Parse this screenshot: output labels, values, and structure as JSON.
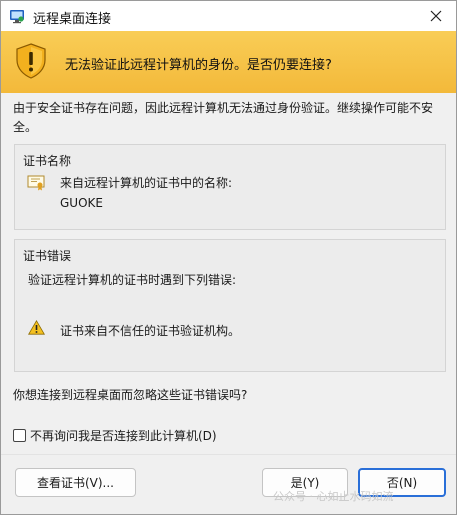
{
  "window": {
    "title": "远程桌面连接"
  },
  "banner": {
    "message": "无法验证此远程计算机的身份。是否仍要连接?"
  },
  "intro": "由于安全证书存在问题，因此远程计算机无法通过身份验证。继续操作可能不安全。",
  "cert_name_group": {
    "title": "证书名称",
    "label": "来自远程计算机的证书中的名称:",
    "value": "GUOKE"
  },
  "cert_error_group": {
    "title": "证书错误",
    "description": "验证远程计算机的证书时遇到下列错误:",
    "error": "证书来自不信任的证书验证机构。"
  },
  "question": "你想连接到远程桌面而忽略这些证书错误吗?",
  "checkbox": {
    "label": "不再询问我是否连接到此计算机(D)",
    "checked": false
  },
  "buttons": {
    "view_cert": "查看证书(V)...",
    "yes": "是(Y)",
    "no": "否(N)"
  },
  "watermark": {
    "text": "公众号 · 心如止水码如流"
  },
  "colors": {
    "banner": "#f5c146",
    "focus_border": "#2a6fd8"
  }
}
